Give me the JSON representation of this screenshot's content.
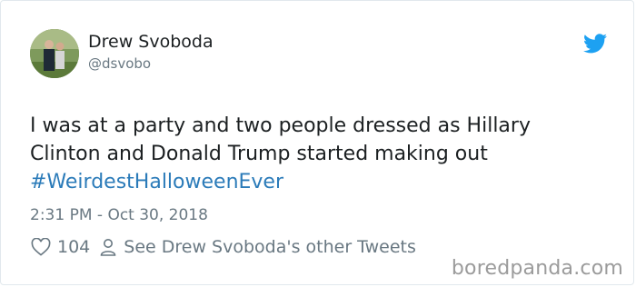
{
  "colors": {
    "link": "#2b7bb9",
    "muted": "#697882",
    "twitter_blue": "#1da1f2",
    "text": "#1c2022"
  },
  "author": {
    "name": "Drew Svoboda",
    "handle": "@dsvobo",
    "avatar_icon": "user-photo"
  },
  "brand_icon": "twitter-bird-icon",
  "tweet": {
    "line1": "I was at a party and two people dressed as Hillary",
    "line2": "Clinton and Donald Trump started making out",
    "hashtag": "#WeirdestHalloweenEver"
  },
  "timestamp": "2:31 PM - Oct 30, 2018",
  "actions": {
    "like_icon": "heart-icon",
    "like_count": "104",
    "profile_icon": "person-icon",
    "profile_link": "See Drew Svoboda's other Tweets"
  },
  "watermark": "boredpanda.com"
}
